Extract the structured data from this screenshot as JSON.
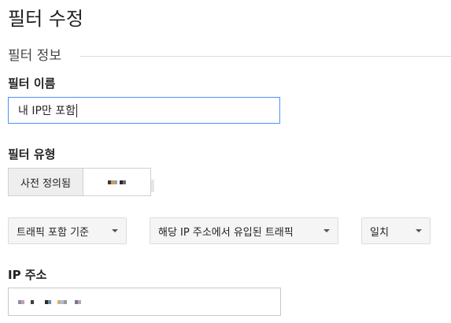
{
  "page_title": "필터 수정",
  "section_title": "필터 정보",
  "filter_name": {
    "label": "필터 이름",
    "value": "내 IP만 포함"
  },
  "filter_type": {
    "label": "필터 유형",
    "segments": [
      {
        "label": "사전 정의됨",
        "selected": true
      },
      {
        "label": "",
        "selected": false
      }
    ]
  },
  "dropdowns": [
    {
      "label": "트래픽 포함 기준"
    },
    {
      "label": "해당 IP 주소에서 유입된 트래픽"
    },
    {
      "label": "일치"
    }
  ],
  "ip_address": {
    "label": "IP 주소",
    "value": ""
  }
}
